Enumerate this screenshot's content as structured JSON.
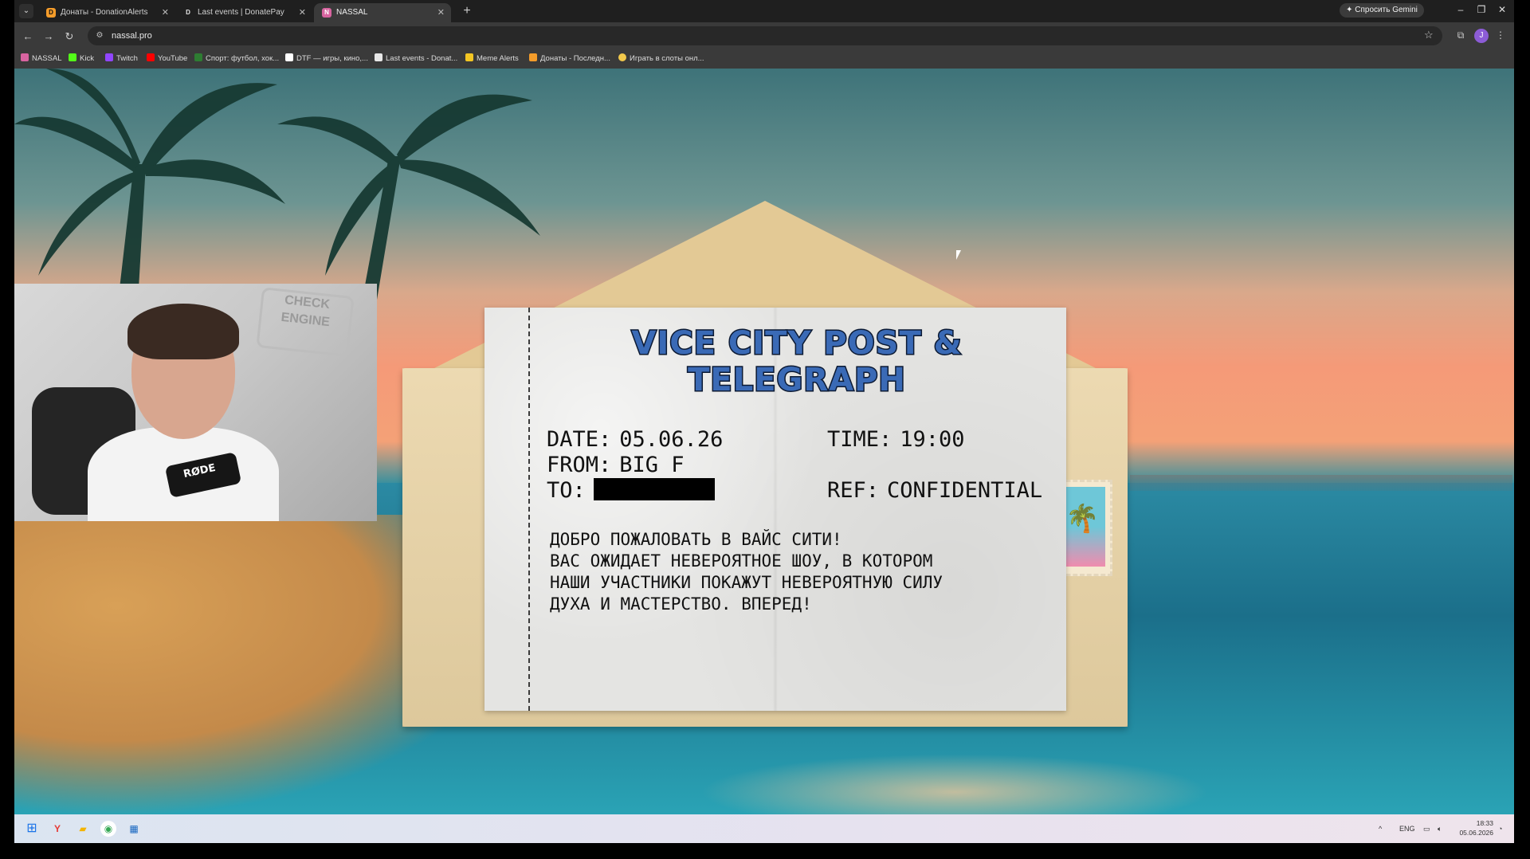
{
  "browser": {
    "tabs": [
      {
        "title": "Донаты - DonationAlerts",
        "favicon_color": "#f49c2a",
        "favicon_letter": "D"
      },
      {
        "title": "Last events | DonatePay",
        "favicon_color": "#e7e7e7",
        "favicon_letter": "D"
      },
      {
        "title": "NASSAL",
        "favicon_color": "#d864a0",
        "favicon_letter": "N"
      }
    ],
    "gemini_button": "✦ Спросить Gemini",
    "url": "nassal.pro",
    "avatar_letter": "J",
    "bookmarks": [
      {
        "label": "NASSAL",
        "color": "#d864a0"
      },
      {
        "label": "Kick",
        "color": "#53fc18"
      },
      {
        "label": "Twitch",
        "color": "#9146ff"
      },
      {
        "label": "YouTube",
        "color": "#ff0000"
      },
      {
        "label": "Спорт: футбол, хок...",
        "color": "#2e7d32"
      },
      {
        "label": "DTF — игры, кино,...",
        "color": "#ffffff"
      },
      {
        "label": "Last events - Donat...",
        "color": "#e7e7e7"
      },
      {
        "label": "Meme Alerts",
        "color": "#f3c623"
      },
      {
        "label": "Донаты - Последн...",
        "color": "#f49c2a"
      },
      {
        "label": "Играть в слоты онл...",
        "color": "#f2c94c"
      }
    ]
  },
  "webcam": {
    "sign": "CHECK ENGINE",
    "mic_brand": "RØDE"
  },
  "letter": {
    "title": "VICE CITY POST & TELEGRAPH",
    "date_label": "DATE:",
    "date_value": "05.06.26",
    "time_label": "TIME:",
    "time_value": "19:00",
    "from_label": "FROM:",
    "from_value": "BIG F",
    "to_label": "TO:",
    "ref_label": "REF:",
    "ref_value": "CONFIDENTIAL",
    "message": [
      "ДОБРО ПОЖАЛОВАТЬ В ВАЙС СИТИ!",
      "ВАС ОЖИДАЕТ НЕВЕРОЯТНОЕ ШОУ, В КОТОРОМ",
      "НАШИ УЧАСТНИКИ ПОКАЖУТ НЕВЕРОЯТНУЮ СИЛУ",
      "ДУХА И МАСТЕРСТВО. ВПЕРЕД!"
    ]
  },
  "taskbar": {
    "lang": "ENG",
    "time": "18:33",
    "date": "05.06.2026"
  }
}
